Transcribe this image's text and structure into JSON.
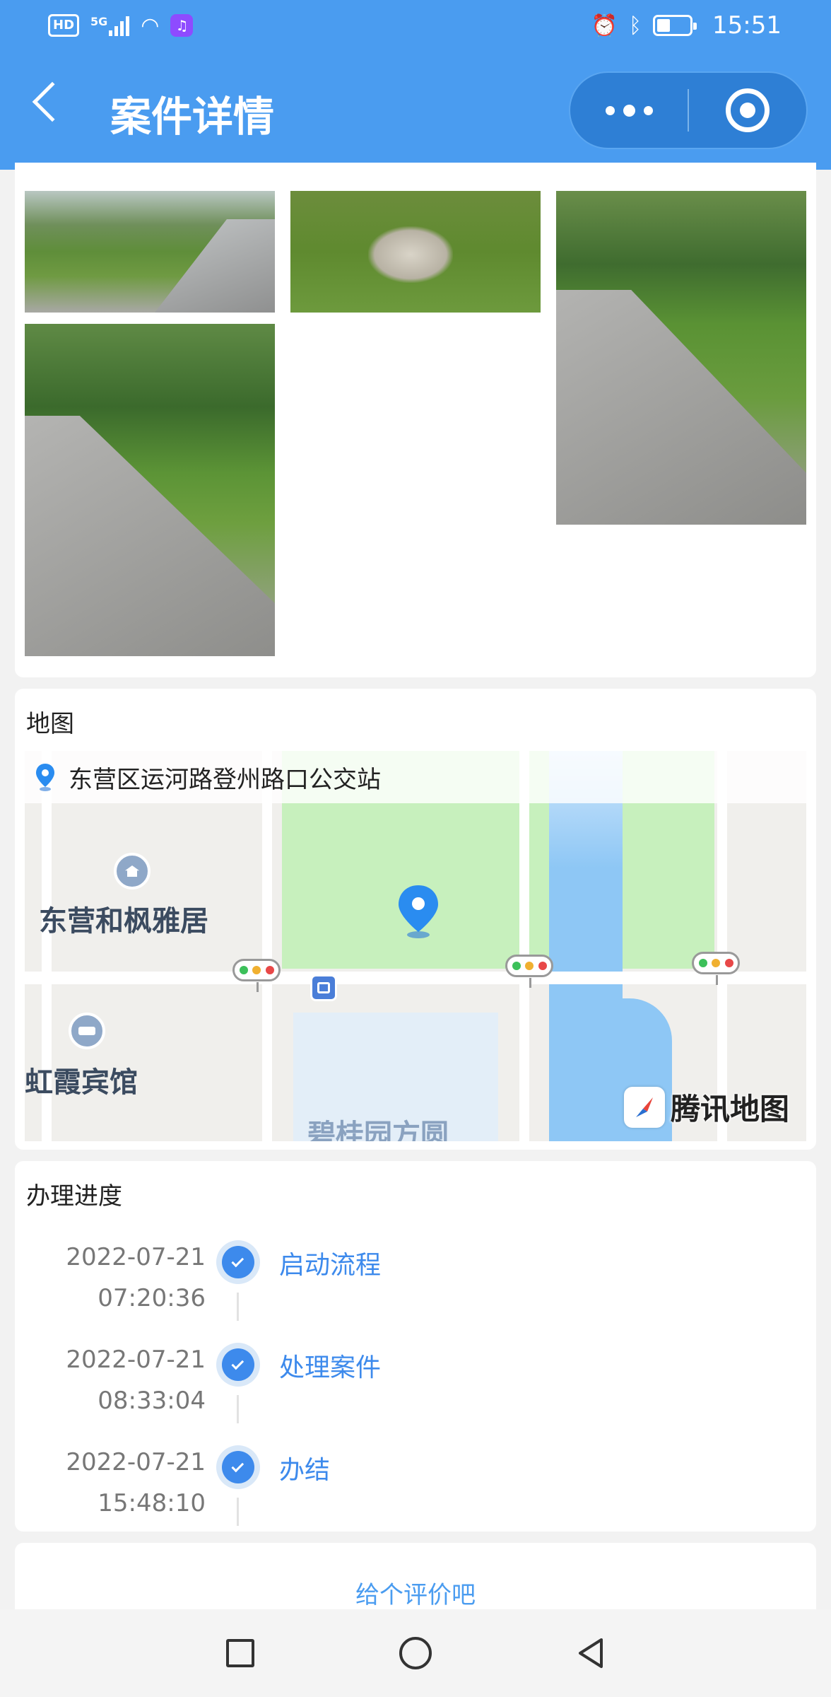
{
  "status_bar": {
    "hd_badge": "HD",
    "network": "5G",
    "time": "15:51"
  },
  "header": {
    "title": "案件详情"
  },
  "map_section": {
    "title": "地图",
    "address": "东营区运河路登州路口公交站",
    "pois": [
      "东营和枫雅居",
      "虹霞宾馆",
      "碧桂园方圆"
    ],
    "provider_logo": "腾讯地图"
  },
  "progress_section": {
    "title": "办理进度",
    "steps": [
      {
        "date": "2022-07-21",
        "time": "07:20:36",
        "label": "启动流程"
      },
      {
        "date": "2022-07-21",
        "time": "08:33:04",
        "label": "处理案件"
      },
      {
        "date": "2022-07-21",
        "time": "15:48:10",
        "label": "办结"
      }
    ]
  },
  "rating": {
    "label": "给个评价吧"
  },
  "colors": {
    "header_bg": "#4a9cf0",
    "accent": "#3d8aec",
    "page_bg": "#f2f2f2"
  }
}
